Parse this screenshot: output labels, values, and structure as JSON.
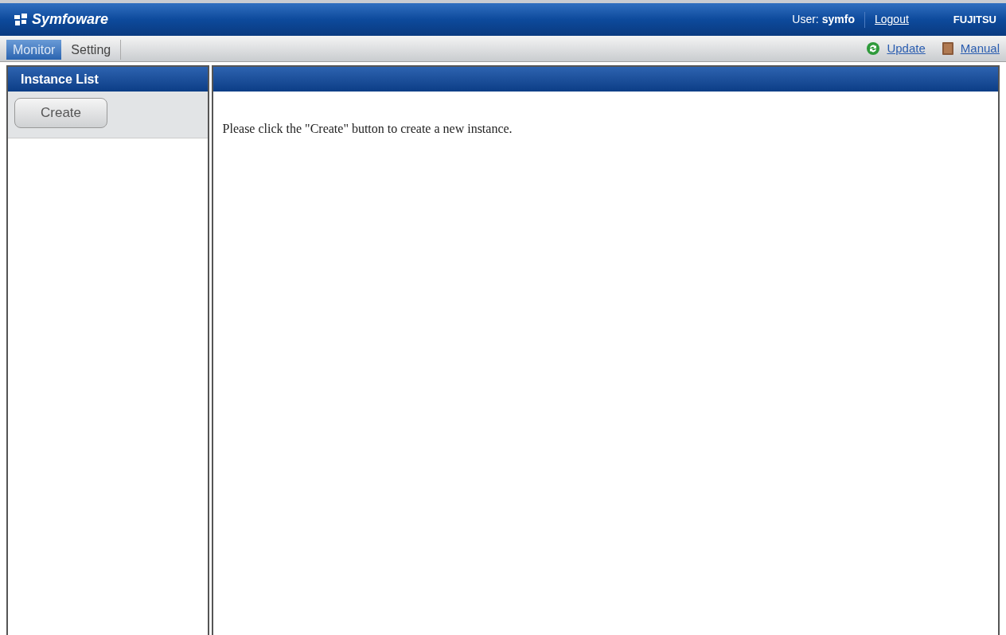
{
  "header": {
    "product": "Symfoware",
    "user_label": "User:",
    "user_name": "symfo",
    "logout": "Logout",
    "vendor": "FUJITSU"
  },
  "tabs": [
    {
      "label": "Monitor",
      "selected": true
    },
    {
      "label": "Setting",
      "selected": false
    }
  ],
  "toolbar_links": [
    {
      "label": "Update",
      "kind": "update"
    },
    {
      "label": "Manual",
      "kind": "manual"
    }
  ],
  "sidebar": {
    "title": "Instance List",
    "button": "Create"
  },
  "content": {
    "message": "Please click the \"Create\" button to create a new instance."
  }
}
